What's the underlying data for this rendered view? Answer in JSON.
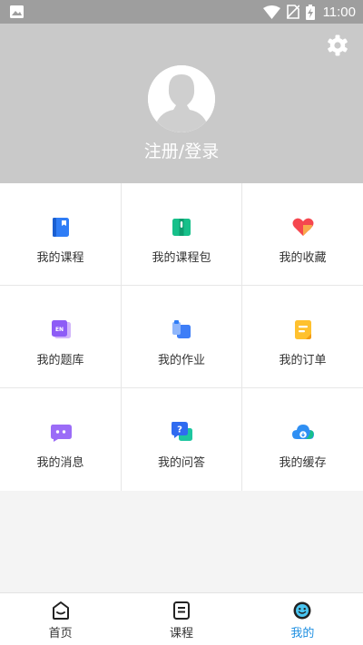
{
  "status_bar": {
    "time": "11:00",
    "icons": [
      "gallery-icon",
      "wifi-icon",
      "no-sim-icon",
      "battery-charging-icon"
    ]
  },
  "header": {
    "login_text": "注册/登录",
    "settings_icon": "gear-icon",
    "avatar_icon": "default-avatar-icon"
  },
  "grid": {
    "items": [
      {
        "label": "我的课程",
        "icon": "book-icon"
      },
      {
        "label": "我的课程包",
        "icon": "course-package-icon"
      },
      {
        "label": "我的收藏",
        "icon": "heart-icon"
      },
      {
        "label": "我的题库",
        "icon": "question-bank-icon"
      },
      {
        "label": "我的作业",
        "icon": "homework-icon"
      },
      {
        "label": "我的订单",
        "icon": "order-icon"
      },
      {
        "label": "我的消息",
        "icon": "message-icon"
      },
      {
        "label": "我的问答",
        "icon": "qa-icon"
      },
      {
        "label": "我的缓存",
        "icon": "cloud-download-icon"
      }
    ]
  },
  "tabbar": {
    "tabs": [
      {
        "label": "首页",
        "icon": "home-icon"
      },
      {
        "label": "课程",
        "icon": "course-icon"
      },
      {
        "label": "我的",
        "icon": "profile-icon",
        "active": true
      }
    ]
  },
  "colors": {
    "status_bar": "#9e9e9e",
    "header_bg": "#c9c9c9",
    "active_tab": "#1e8fe1",
    "page_bg": "#f4f4f4"
  }
}
